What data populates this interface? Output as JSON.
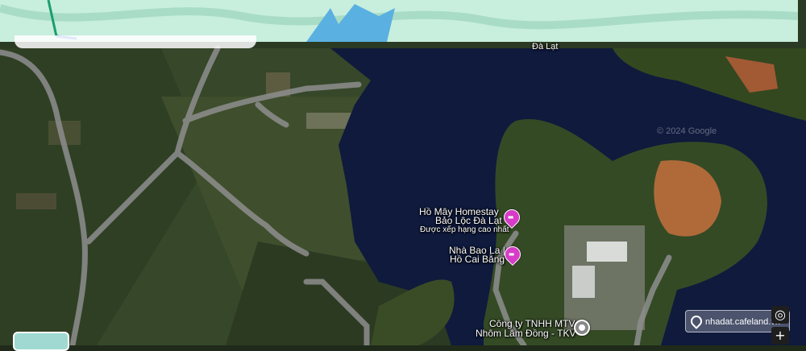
{
  "map": {
    "watermark": "nhadat.cafeland.vn",
    "copyright": "© 2024 Google",
    "top_partial_label": "Đà Lạt"
  },
  "pois": [
    {
      "name_line1": "Hồ Mây Homestay",
      "name_line2": "Bảo Lộc Đà Lạt",
      "subtitle": "Được xếp hạng cao nhất",
      "icon": "lodging-icon",
      "color": "#d63cc7"
    },
    {
      "name_line1": "Nhà Bao La |",
      "name_line2": "Hồ Cai Bằng",
      "icon": "lodging-icon",
      "color": "#d63cc7"
    },
    {
      "name_line1": "Công ty TNHH MTV",
      "name_line2": "Nhôm Lâm Đồng - TKV",
      "icon": "place-icon",
      "color": "#888888"
    }
  ],
  "controls": {
    "locate_symbol": "◎",
    "zoom_in_symbol": "+"
  }
}
